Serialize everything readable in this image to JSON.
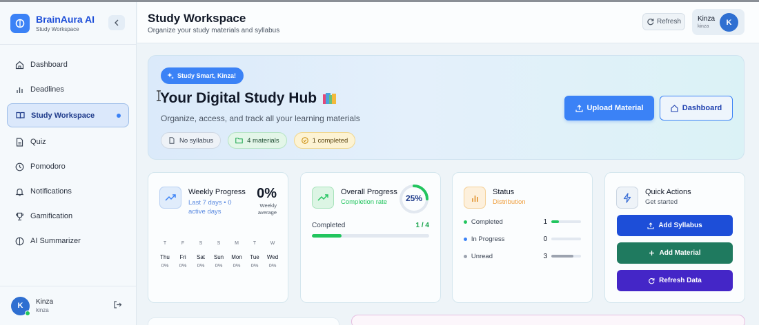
{
  "brand": {
    "title": "BrainAura AI",
    "subtitle": "Study Workspace"
  },
  "nav": [
    {
      "label": "Dashboard",
      "icon": "home-icon"
    },
    {
      "label": "Deadlines",
      "icon": "bar-chart-icon"
    },
    {
      "label": "Study Workspace",
      "icon": "book-open-icon",
      "active": true
    },
    {
      "label": "Quiz",
      "icon": "file-text-icon"
    },
    {
      "label": "Pomodoro",
      "icon": "clock-icon"
    },
    {
      "label": "Notifications",
      "icon": "bell-icon"
    },
    {
      "label": "Gamification",
      "icon": "trophy-icon"
    },
    {
      "label": "AI Summarizer",
      "icon": "brain-icon"
    }
  ],
  "sidebar_user": {
    "initial": "K",
    "name": "Kinza",
    "handle": "kinza"
  },
  "header": {
    "title": "Study Workspace",
    "subtitle": "Organize your study materials and syllabus",
    "refresh_label": "Refresh",
    "user": {
      "name": "Kinza",
      "handle": "kinza",
      "initial": "K"
    }
  },
  "hero": {
    "badge": "Study Smart, Kinza!",
    "title": "Your Digital Study Hub",
    "subtitle": "Organize, access, and track all your learning materials",
    "tags": [
      "No syllabus",
      "4 materials",
      "1 completed"
    ],
    "upload_label": "Upload Material",
    "dashboard_label": "Dashboard"
  },
  "weekly": {
    "title": "Weekly Progress",
    "subtitle": "Last 7 days • 0 active days",
    "percent": "0%",
    "percent_caption": "Weekly average",
    "days": [
      {
        "letter": "T",
        "day": "Thu",
        "value": "0%"
      },
      {
        "letter": "F",
        "day": "Fri",
        "value": "0%"
      },
      {
        "letter": "S",
        "day": "Sat",
        "value": "0%"
      },
      {
        "letter": "S",
        "day": "Sun",
        "value": "0%"
      },
      {
        "letter": "M",
        "day": "Mon",
        "value": "0%"
      },
      {
        "letter": "T",
        "day": "Tue",
        "value": "0%"
      },
      {
        "letter": "W",
        "day": "Wed",
        "value": "0%"
      }
    ]
  },
  "overall": {
    "title": "Overall Progress",
    "subtitle": "Completion rate",
    "percent_label": "25%",
    "completed_label": "Completed",
    "completed_value": "1 / 4",
    "progress": 0.25
  },
  "status": {
    "title": "Status",
    "subtitle": "Distribution",
    "rows": [
      {
        "label": "Completed",
        "count": "1",
        "fraction": 0.25,
        "color": "#22c55e"
      },
      {
        "label": "In Progress",
        "count": "0",
        "fraction": 0,
        "color": "#3b82f6"
      },
      {
        "label": "Unread",
        "count": "3",
        "fraction": 0.75,
        "color": "#9ca3af"
      }
    ]
  },
  "quick": {
    "title": "Quick Actions",
    "subtitle": "Get started",
    "buttons": [
      {
        "label": "Add Syllabus",
        "color": "#1d4ed8"
      },
      {
        "label": "Add Material",
        "color": "#1f7a5f"
      },
      {
        "label": "Refresh Data",
        "color": "#4426c7"
      }
    ]
  },
  "colors": {
    "accent": "#3b82f6",
    "success": "#22c55e",
    "warning": "#f0a040"
  }
}
